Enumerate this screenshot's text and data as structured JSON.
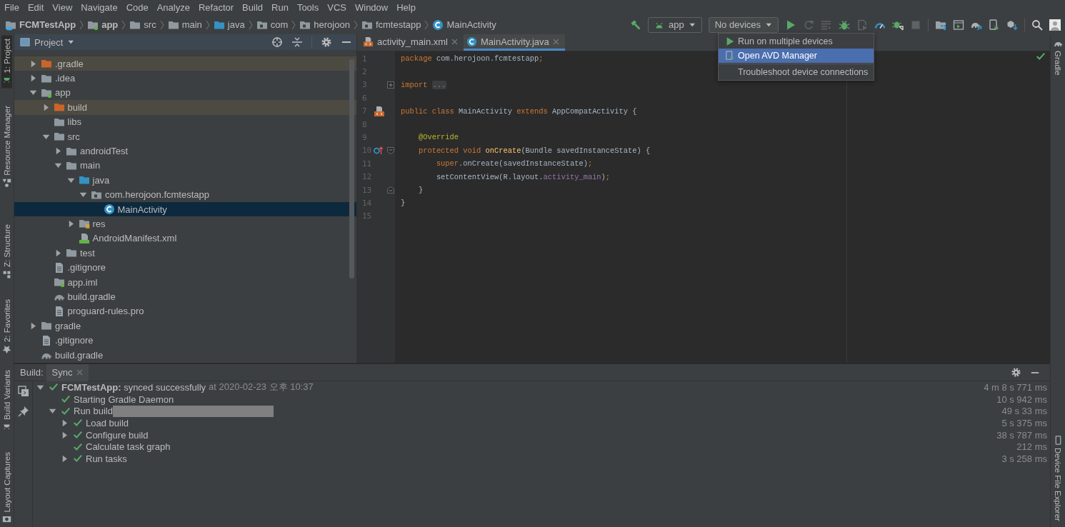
{
  "menu_bar": [
    "File",
    "Edit",
    "View",
    "Navigate",
    "Code",
    "Analyze",
    "Refactor",
    "Build",
    "Run",
    "Tools",
    "VCS",
    "Window",
    "Help"
  ],
  "breadcrumbs": [
    {
      "label": "FCMTestApp",
      "kind": "project"
    },
    {
      "label": "app",
      "kind": "module"
    },
    {
      "label": "src",
      "kind": "folder"
    },
    {
      "label": "main",
      "kind": "folder"
    },
    {
      "label": "java",
      "kind": "source-folder"
    },
    {
      "label": "com",
      "kind": "package"
    },
    {
      "label": "herojoon",
      "kind": "package"
    },
    {
      "label": "fcmtestapp",
      "kind": "package"
    },
    {
      "label": "MainActivity",
      "kind": "class"
    }
  ],
  "toolbar": [
    {
      "kind": "make",
      "disabled": false
    },
    {
      "kind": "run-config",
      "label": "app"
    },
    {
      "kind": "device-selector",
      "label": "No devices",
      "menu": [
        [
          {
            "label": "Run on multiple devices",
            "kind": "run",
            "selected": false
          },
          {
            "label": "Open AVD Manager",
            "kind": "avd",
            "selected": true
          }
        ],
        [
          {
            "label": "Troubleshoot device connections",
            "kind": "plain",
            "selected": false
          }
        ]
      ]
    },
    {
      "kind": "run",
      "disabled": false
    },
    {
      "kind": "apply-changes",
      "disabled": true
    },
    {
      "kind": "apply-code",
      "disabled": true
    },
    {
      "kind": "debug",
      "disabled": false
    },
    {
      "kind": "attach-process",
      "disabled": true
    },
    {
      "kind": "profile",
      "disabled": false
    },
    {
      "kind": "attach-debugger",
      "disabled": false
    },
    {
      "kind": "stop",
      "disabled": true
    },
    {
      "kind": "separator"
    },
    {
      "kind": "project-structure",
      "disabled": false
    },
    {
      "kind": "layout-inspector",
      "disabled": false
    },
    {
      "kind": "sync",
      "disabled": false
    },
    {
      "kind": "avd-manager",
      "disabled": false
    },
    {
      "kind": "sdk-manager",
      "disabled": false
    },
    {
      "kind": "separator"
    },
    {
      "kind": "search",
      "disabled": false
    },
    {
      "kind": "account"
    }
  ],
  "left_tool_strip": {
    "upper": [
      {
        "label": "1: Project",
        "kind": "project",
        "selected": true
      },
      {
        "label": "Resource Manager",
        "kind": "resources",
        "selected": false
      }
    ],
    "lower": [
      {
        "label": "Z: Structure",
        "kind": "structure",
        "selected": false
      },
      {
        "label": "2: Favorites",
        "kind": "favorites",
        "selected": false
      }
    ],
    "bottom": [
      {
        "label": "Build Variants",
        "kind": "build-variants",
        "selected": false
      },
      {
        "label": "Layout Captures",
        "kind": "layout-captures",
        "selected": false
      }
    ]
  },
  "right_tool_strip": {
    "upper": [
      {
        "label": "Gradle",
        "kind": "gradle",
        "selected": false
      }
    ],
    "bottom": [
      {
        "label": "Device File Explorer",
        "kind": "device-explorer",
        "selected": false
      }
    ]
  },
  "project_panel": {
    "view": "Project",
    "tree": [
      {
        "label": ".gradle",
        "kind": "excluded-folder",
        "expanded": false,
        "selected": false
      },
      {
        "label": ".idea",
        "kind": "folder",
        "expanded": false,
        "selected": false
      },
      {
        "label": "app",
        "kind": "module",
        "expanded": true,
        "selected": false,
        "children": [
          {
            "label": "build",
            "kind": "excluded-folder",
            "expanded": false,
            "selected": false
          },
          {
            "label": "libs",
            "kind": "folder",
            "selected": false
          },
          {
            "label": "src",
            "kind": "folder",
            "expanded": true,
            "selected": false,
            "children": [
              {
                "label": "androidTest",
                "kind": "folder",
                "expanded": false,
                "selected": false
              },
              {
                "label": "main",
                "kind": "folder",
                "expanded": true,
                "selected": false,
                "children": [
                  {
                    "label": "java",
                    "kind": "source-folder",
                    "expanded": true,
                    "selected": false,
                    "children": [
                      {
                        "label": "com.herojoon.fcmtestapp",
                        "kind": "package",
                        "expanded": true,
                        "selected": false,
                        "children": [
                          {
                            "label": "MainActivity",
                            "kind": "class",
                            "selected": true
                          }
                        ]
                      }
                    ]
                  },
                  {
                    "label": "res",
                    "kind": "resources",
                    "expanded": false,
                    "selected": false
                  },
                  {
                    "label": "AndroidManifest.xml",
                    "kind": "manifest",
                    "selected": false
                  }
                ]
              },
              {
                "label": "test",
                "kind": "folder",
                "expanded": false,
                "selected": false
              }
            ]
          },
          {
            "label": ".gitignore",
            "kind": "text-file",
            "selected": false
          },
          {
            "label": "app.iml",
            "kind": "module-file",
            "selected": false
          },
          {
            "label": "build.gradle",
            "kind": "gradle-file",
            "selected": false
          },
          {
            "label": "proguard-rules.pro",
            "kind": "text-file",
            "selected": false
          }
        ]
      },
      {
        "label": "gradle",
        "kind": "folder",
        "expanded": false,
        "selected": false
      },
      {
        "label": ".gitignore",
        "kind": "text-file",
        "selected": false
      },
      {
        "label": "build.gradle",
        "kind": "gradle-file",
        "selected": false
      }
    ]
  },
  "editor": {
    "tabs": [
      {
        "label": "activity_main.xml",
        "kind": "layout",
        "selected": false
      },
      {
        "label": "MainActivity.java",
        "kind": "class",
        "selected": true
      }
    ],
    "lines": [
      {
        "number": "1",
        "tokens": [
          {
            "text": "package ",
            "kind": "keyword"
          },
          {
            "text": "com.herojoon.fcmtestapp",
            "kind": "plain"
          },
          {
            "text": ";",
            "kind": "keyword"
          }
        ]
      },
      {
        "number": "2"
      },
      {
        "number": "3",
        "fold_marker": {
          "kind": "collapsed"
        },
        "tokens": [
          {
            "text": "import ",
            "kind": "keyword"
          },
          {
            "text": "...",
            "kind": "folded"
          }
        ]
      },
      {
        "number": "6"
      },
      {
        "number": "7",
        "gutter_icon": {
          "kind": "layout"
        },
        "tokens": [
          {
            "text": "public class ",
            "kind": "keyword"
          },
          {
            "text": "MainActivity ",
            "kind": "plain"
          },
          {
            "text": "extends ",
            "kind": "keyword"
          },
          {
            "text": "AppCompatActivity {",
            "kind": "plain"
          }
        ]
      },
      {
        "number": "8"
      },
      {
        "number": "9",
        "tokens": [
          {
            "text": "    @Override",
            "kind": "annotation"
          }
        ]
      },
      {
        "number": "10",
        "gutter_icon": {
          "kind": "override"
        },
        "fold_marker": {
          "kind": "start"
        },
        "tokens": [
          {
            "text": "    protected void ",
            "kind": "keyword"
          },
          {
            "text": "onCreate",
            "kind": "method"
          },
          {
            "text": "(Bundle savedInstanceState) {",
            "kind": "plain"
          }
        ]
      },
      {
        "number": "11",
        "tokens": [
          {
            "text": "        super",
            "kind": "keyword"
          },
          {
            "text": ".onCreate(savedInstanceState)",
            "kind": "plain"
          },
          {
            "text": ";",
            "kind": "keyword"
          }
        ]
      },
      {
        "number": "12",
        "tokens": [
          {
            "text": "        setContentView(R.layout.",
            "kind": "plain"
          },
          {
            "text": "activity_main",
            "kind": "field"
          },
          {
            "text": ")",
            "kind": "plain"
          },
          {
            "text": ";",
            "kind": "keyword"
          }
        ]
      },
      {
        "number": "13",
        "fold_marker": {
          "kind": "end"
        },
        "tokens": [
          {
            "text": "    }",
            "kind": "plain"
          }
        ]
      },
      {
        "number": "14",
        "tokens": [
          {
            "text": "}",
            "kind": "plain"
          }
        ]
      },
      {
        "number": "15"
      }
    ]
  },
  "build_panel": {
    "title": "Build:",
    "tabs": [
      {
        "label": "Sync",
        "selected": true
      }
    ],
    "tree": [
      {
        "label": "**FCMTestApp:** synced successfully",
        "detail": "at 2020-02-23 오후 10:37",
        "succeeded": true,
        "time": "4 m 8 s 771 ms",
        "expanded": true,
        "children": [
          {
            "label": "Starting Gradle Daemon",
            "succeeded": true,
            "time": "10 s 942 ms"
          },
          {
            "label": "Run build",
            "succeeded": true,
            "time": "49 s 33 ms",
            "redacted": true,
            "expanded": true,
            "children": [
              {
                "label": "Load build",
                "succeeded": true,
                "time": "5 s 375 ms",
                "expanded": false
              },
              {
                "label": "Configure build",
                "succeeded": true,
                "time": "38 s 787 ms",
                "expanded": false
              },
              {
                "label": "Calculate task graph",
                "succeeded": true,
                "time": "212 ms"
              },
              {
                "label": "Run tasks",
                "succeeded": true,
                "time": "3 s 258 ms",
                "expanded": false
              }
            ]
          }
        ]
      }
    ]
  }
}
